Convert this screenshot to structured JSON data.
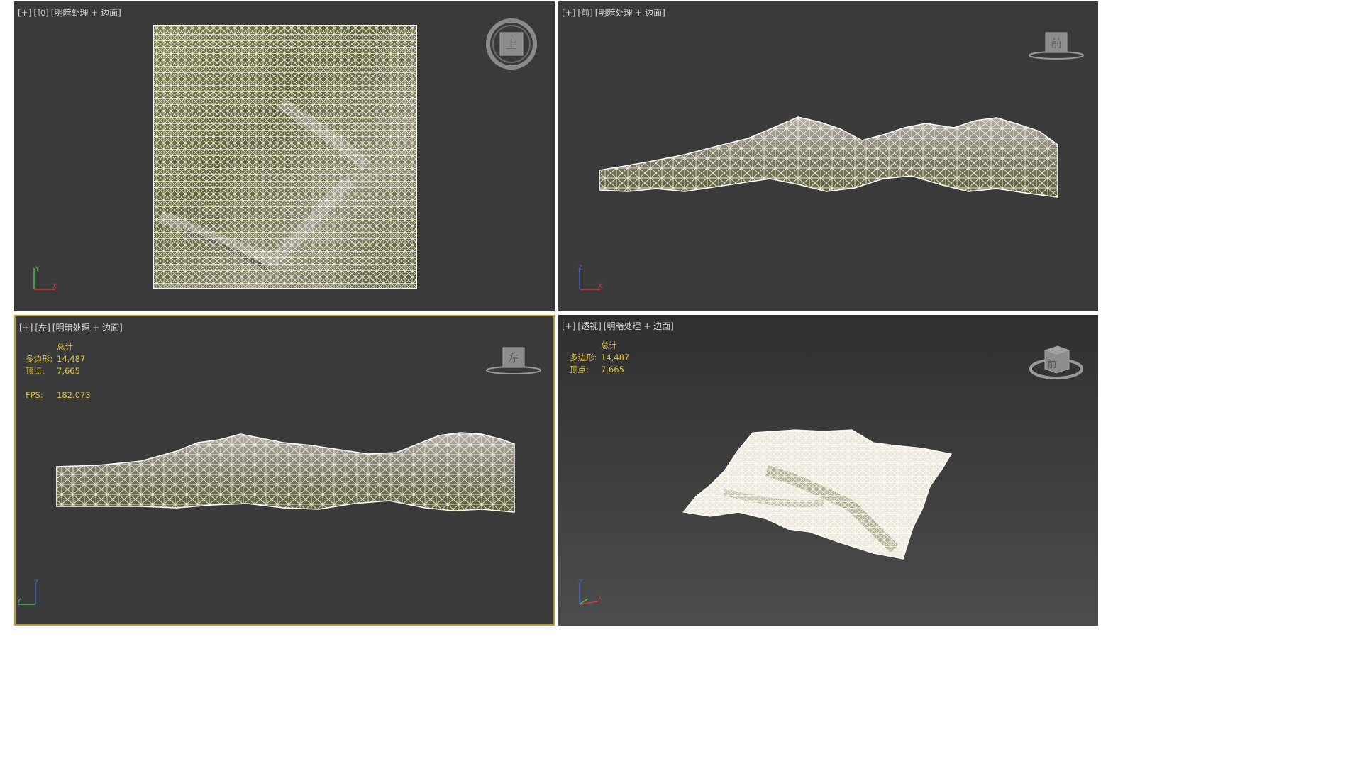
{
  "viewports": {
    "top": {
      "menu": "[+]",
      "view": "[顶]",
      "shading": "[明暗处理 + 边面]",
      "navcube_label": "上",
      "gizmo_axes": [
        "Y",
        "X"
      ]
    },
    "front": {
      "menu": "[+]",
      "view": "[前]",
      "shading": "[明暗处理 + 边面]",
      "navcube_label": "前",
      "gizmo_axes": [
        "Z",
        "X"
      ]
    },
    "left": {
      "menu": "[+]",
      "view": "[左]",
      "shading": "[明暗处理 + 边面]",
      "navcube_label": "左",
      "gizmo_axes": [
        "Z",
        "Y"
      ],
      "stats": {
        "header": "总计",
        "polygons_label": "多边形:",
        "polygons": "14,487",
        "vertices_label": "顶点:",
        "vertices": "7,665",
        "fps_label": "FPS:",
        "fps": "182.073"
      }
    },
    "perspective": {
      "menu": "[+]",
      "view": "[透视]",
      "shading": "[明暗处理 + 边面]",
      "navcube_label": "前",
      "gizmo_axes": [
        "Z",
        "X"
      ],
      "stats": {
        "header": "总计",
        "polygons_label": "多边形:",
        "polygons": "14,487",
        "vertices_label": "顶点:",
        "vertices": "7,665"
      }
    }
  },
  "colors": {
    "viewport_bg": "#3a3a3a",
    "active_border": "#b9952f",
    "stats_text": "#e6c23a",
    "terrain": "#6e7040",
    "wire": "#ffffff"
  }
}
